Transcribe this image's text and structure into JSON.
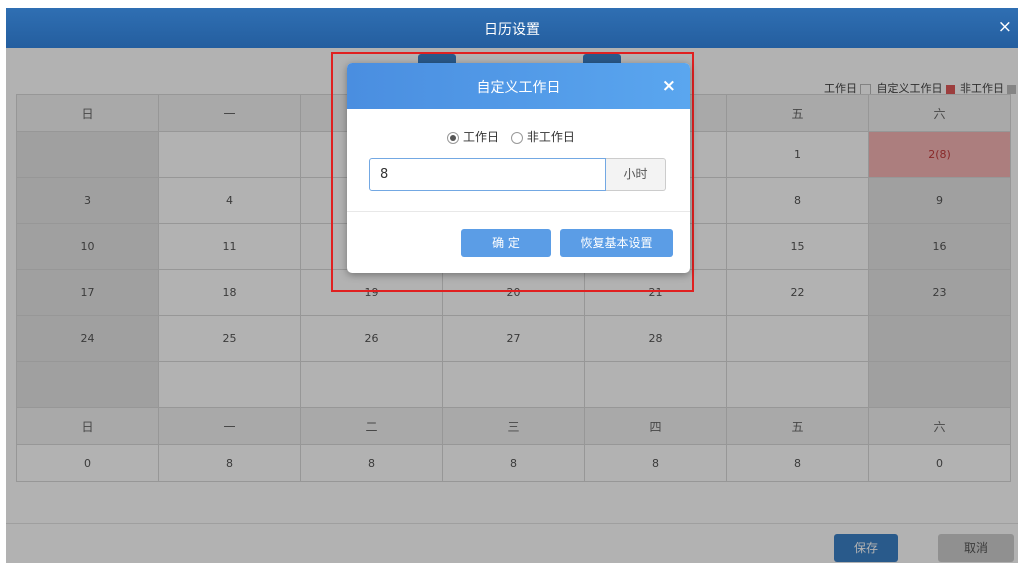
{
  "window": {
    "title": "日历设置",
    "close": "×"
  },
  "legend": {
    "items": [
      {
        "label": "工作日",
        "color": "#ffffff"
      },
      {
        "label": "自定义工作日",
        "color": "#e05a5a"
      },
      {
        "label": "非工作日",
        "color": "#bdbdbd"
      }
    ]
  },
  "calendar": {
    "weekdays": [
      "日",
      "一",
      "二",
      "三",
      "四",
      "五",
      "六"
    ],
    "weeks": [
      [
        "",
        "",
        "",
        "",
        "",
        "1",
        "2(8)"
      ],
      [
        "3",
        "4",
        "",
        "",
        "",
        "8",
        "9"
      ],
      [
        "10",
        "11",
        "",
        "",
        "",
        "15",
        "16"
      ],
      [
        "17",
        "18",
        "19",
        "20",
        "21",
        "22",
        "23"
      ],
      [
        "24",
        "25",
        "26",
        "27",
        "28",
        "",
        ""
      ],
      [
        "",
        "",
        "",
        "",
        "",
        "",
        ""
      ]
    ],
    "hours_header": [
      "日",
      "一",
      "二",
      "三",
      "四",
      "五",
      "六"
    ],
    "hours": [
      "0",
      "8",
      "8",
      "8",
      "8",
      "8",
      "0"
    ]
  },
  "footer": {
    "save": "保存",
    "cancel": "取消"
  },
  "dialog": {
    "title": "自定义工作日",
    "close": "×",
    "radio_workday": "工作日",
    "radio_nonworkday": "非工作日",
    "hours_value": "8",
    "unit": "小时",
    "confirm": "确 定",
    "reset": "恢复基本设置"
  }
}
